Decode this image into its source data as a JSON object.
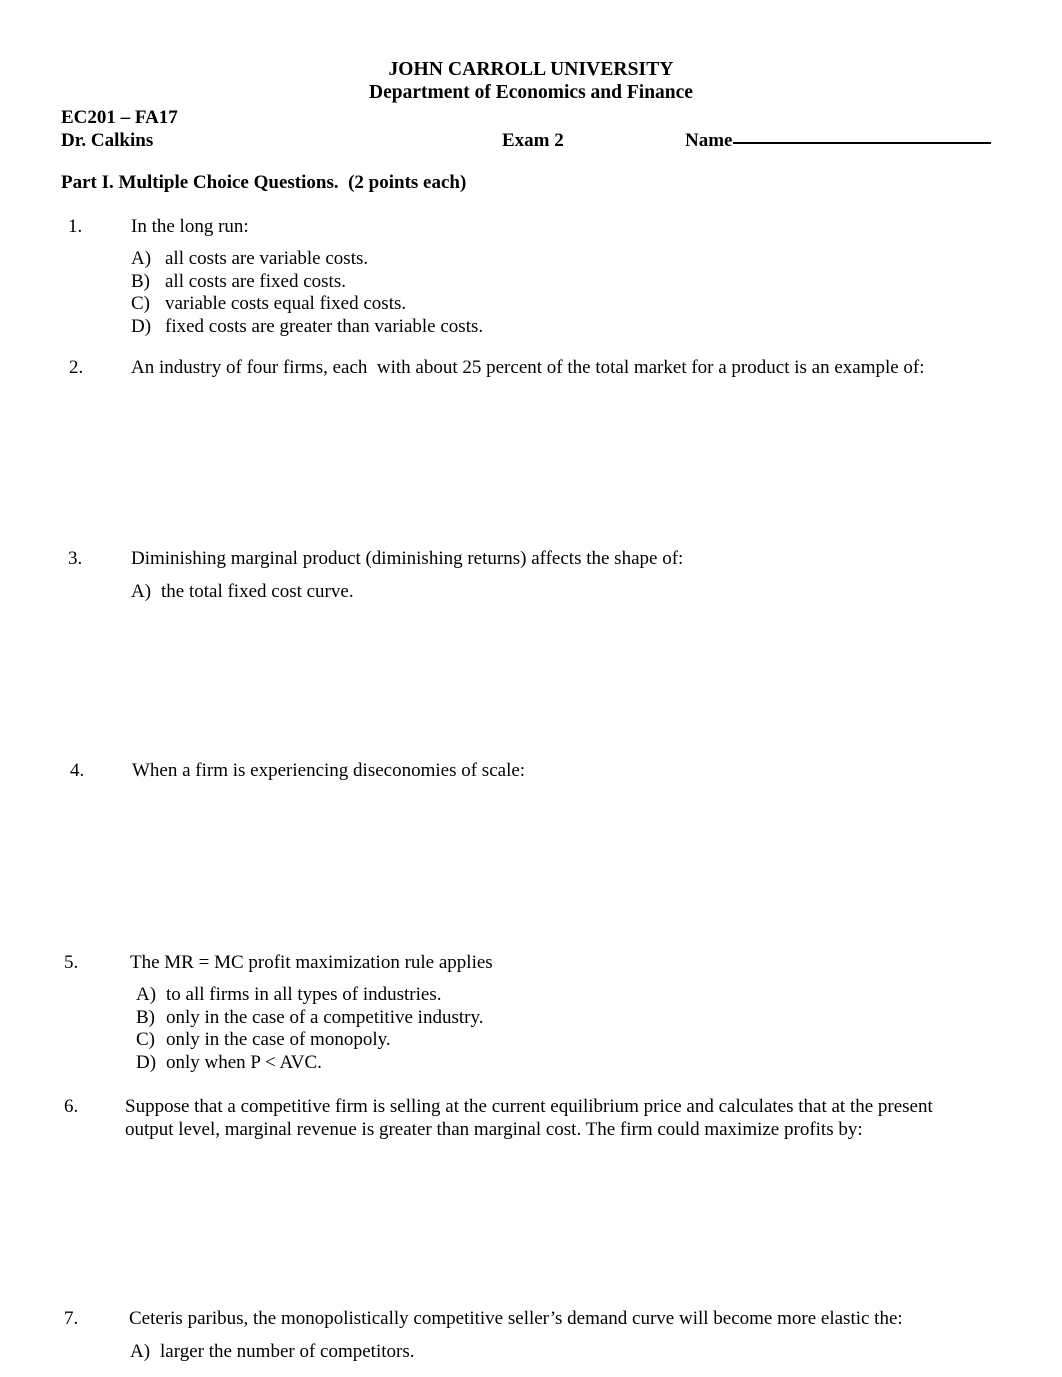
{
  "header": {
    "university": "JOHN CARROLL UNIVERSITY",
    "department": "Department of Economics and Finance",
    "course": "EC201 – FA17",
    "instructor": "Dr. Calkins",
    "exam_label": "Exam 2",
    "name_label": "Name",
    "part_heading": "Part I. Multiple Choice Questions.  (2 points each)"
  },
  "questions": [
    {
      "number": "1.",
      "text": "In the long run:",
      "options": [
        {
          "letter": "A)",
          "text": "all costs are variable costs."
        },
        {
          "letter": "B)",
          "text": "all costs are fixed costs."
        },
        {
          "letter": "C)",
          "text": "variable costs equal fixed costs."
        },
        {
          "letter": "D)",
          "text": "fixed costs are greater than variable costs."
        }
      ]
    },
    {
      "number": "2.",
      "text": "An industry of four firms, each  with about 25 percent of the total market for a product is an example of:",
      "options": []
    },
    {
      "number": "3.",
      "text": "Diminishing marginal product (diminishing returns) affects the shape of:",
      "options": [
        {
          "letter": "A)",
          "text": "the total fixed cost curve."
        }
      ]
    },
    {
      "number": "4.",
      "text": "When a firm is experiencing diseconomies of scale:",
      "options": []
    },
    {
      "number": "5.",
      "text": "The MR = MC profit maximization rule applies",
      "options": [
        {
          "letter": "A)",
          "text": "to all firms in all types of industries."
        },
        {
          "letter": "B)",
          "text": "only in the case of a competitive industry."
        },
        {
          "letter": "C)",
          "text": "only in the case of monopoly."
        },
        {
          "letter": "D)",
          "text": "only when P < AVC."
        }
      ]
    },
    {
      "number": "6.",
      "text": "Suppose that a competitive firm is selling at the current equilibrium price and calculates that at the present output level, marginal revenue is greater than marginal cost. The firm could maximize profits by:",
      "options": []
    },
    {
      "number": "7.",
      "text": "Ceteris paribus, the monopolistically competitive seller’s demand curve will become more elastic the:",
      "options": [
        {
          "letter": "A)",
          "text": "larger the number of competitors."
        }
      ]
    }
  ]
}
